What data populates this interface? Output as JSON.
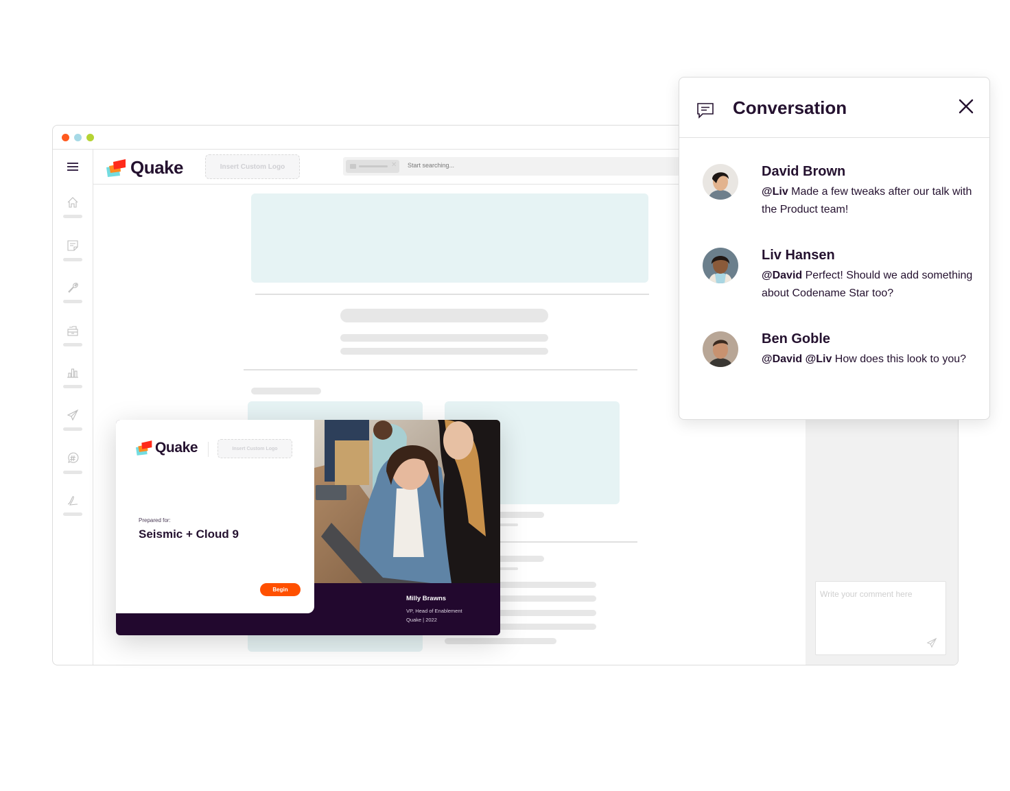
{
  "window": {
    "traffic_lights": [
      "close",
      "minimize",
      "maximize"
    ],
    "colors": {
      "close": "#ff5a1f",
      "minimize": "#a6d9e6",
      "maximize": "#b5d334"
    }
  },
  "header": {
    "brand": "Quake",
    "custom_logo_placeholder": "Insert Custom Logo",
    "search_placeholder": "Start searching..."
  },
  "sidebar": {
    "items": [
      {
        "icon": "home-icon"
      },
      {
        "icon": "note-icon"
      },
      {
        "icon": "wrench-icon"
      },
      {
        "icon": "archive-icon"
      },
      {
        "icon": "bar-chart-icon"
      },
      {
        "icon": "send-icon"
      },
      {
        "icon": "hashtag-chat-icon"
      },
      {
        "icon": "signature-icon"
      }
    ]
  },
  "deck": {
    "brand": "Quake",
    "custom_logo_placeholder": "Insert Custom Logo",
    "prepared_for_label": "Prepared for:",
    "client": "Seismic + Cloud 9",
    "begin_label": "Begin",
    "presenter_name": "Milly Brawns",
    "presenter_title": "VP, Head of Enablement",
    "presenter_company_year": "Quake | 2022"
  },
  "conversation": {
    "title": "Conversation",
    "messages": [
      {
        "author": "David Brown",
        "mentions": "@Liv",
        "body": "Made a few tweaks after our talk with the Product team!"
      },
      {
        "author": "Liv Hansen",
        "mentions": "@David",
        "body": "Perfect! Should we add something about Codename Star too?"
      },
      {
        "author": "Ben Goble",
        "mentions": "@David @Liv",
        "body": "How does this look to you?"
      }
    ],
    "comment_placeholder": "Write your comment here"
  },
  "colors": {
    "brand_dark": "#24112f",
    "accent_orange": "#ff5000",
    "skeleton_teal": "#e6f3f4",
    "skeleton_gray": "#e7e7e7"
  }
}
